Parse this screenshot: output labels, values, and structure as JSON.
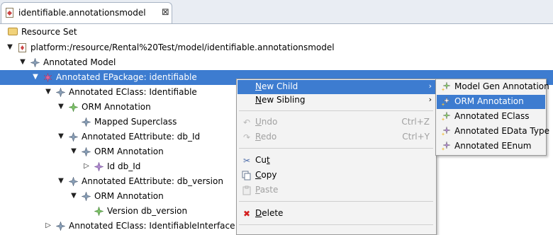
{
  "editor": {
    "tab_title": "identifiable.annotationsmodel",
    "close_glyph": "⊠"
  },
  "toolbar": {
    "root_label": "Resource Set"
  },
  "tree": {
    "rows": [
      {
        "label": "platform:/resource/Rental%20Test/model/identifiable.annotationsmodel",
        "twisty": "expanded",
        "icon": "model-file-icon"
      },
      {
        "label": "Annotated Model",
        "twisty": "expanded",
        "icon": "diamond-icon"
      },
      {
        "label": "Annotated EPackage: identifiable",
        "twisty": "expanded",
        "icon": "star-icon",
        "selected": true
      },
      {
        "label": "Annotated EClass: Identifiable",
        "twisty": "expanded",
        "icon": "diamond-icon"
      },
      {
        "label": "ORM Annotation",
        "twisty": "expanded",
        "icon": "diamond-green-icon"
      },
      {
        "label": "Mapped Superclass",
        "twisty": "none",
        "icon": "diamond-icon"
      },
      {
        "label": "Annotated EAttribute: db_Id",
        "twisty": "expanded",
        "icon": "diamond-icon"
      },
      {
        "label": "ORM Annotation",
        "twisty": "expanded",
        "icon": "diamond-icon"
      },
      {
        "label": "Id db_Id",
        "twisty": "collapsed",
        "icon": "diamond-purple-icon"
      },
      {
        "label": "Annotated EAttribute: db_version",
        "twisty": "expanded",
        "icon": "diamond-icon"
      },
      {
        "label": "ORM Annotation",
        "twisty": "expanded",
        "icon": "diamond-icon"
      },
      {
        "label": "Version db_version",
        "twisty": "none",
        "icon": "diamond-green-icon"
      },
      {
        "label": "Annotated EClass: IdentifiableInterface",
        "twisty": "collapsed",
        "icon": "diamond-icon"
      }
    ]
  },
  "context_menu": {
    "new_child": {
      "pre": "",
      "mnemonic": "N",
      "post": "ew Child"
    },
    "new_sibling": {
      "pre": "",
      "mnemonic": "N",
      "post": "ew Sibling"
    },
    "undo": {
      "pre": "",
      "mnemonic": "U",
      "post": "ndo",
      "accel": "Ctrl+Z"
    },
    "redo": {
      "pre": "",
      "mnemonic": "R",
      "post": "edo",
      "accel": "Ctrl+Y"
    },
    "cut": {
      "pre": "Cu",
      "mnemonic": "t",
      "post": ""
    },
    "copy": {
      "pre": "",
      "mnemonic": "C",
      "post": "opy"
    },
    "paste": {
      "pre": "",
      "mnemonic": "P",
      "post": "aste"
    },
    "delete": {
      "pre": "",
      "mnemonic": "D",
      "post": "elete"
    },
    "submenu_arrow": "›"
  },
  "submenu": {
    "items": [
      {
        "label": "Model Gen Annotation",
        "active": false
      },
      {
        "label": "ORM Annotation",
        "active": true
      },
      {
        "label": "Annotated EClass",
        "active": false
      },
      {
        "label": "Annotated EData Type",
        "active": false
      },
      {
        "label": "Annotated EEnum",
        "active": false
      }
    ]
  },
  "colors": {
    "selection": "#3d7cd0",
    "menu_bg": "#f3f3f3",
    "disabled_text": "#a0a0a0",
    "tab_bar_bg": "#e9edf3"
  }
}
